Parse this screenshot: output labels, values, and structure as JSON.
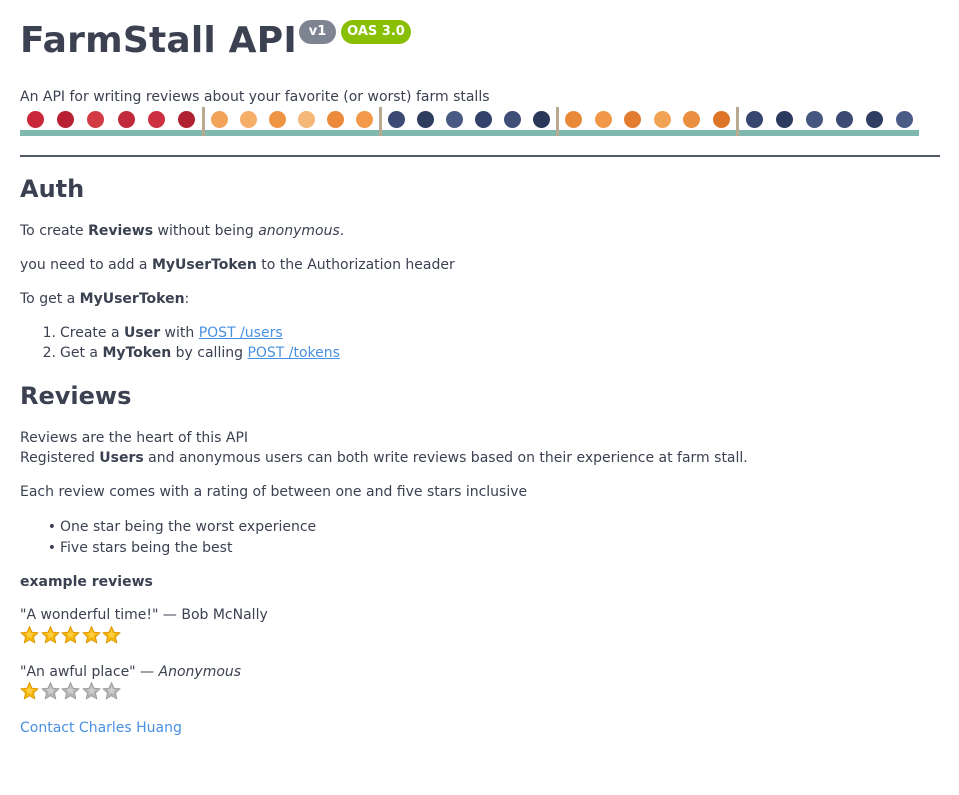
{
  "header": {
    "title": "FarmStall API",
    "version_badge": "v1",
    "oas_badge": "OAS 3.0",
    "description": "An API for writing reviews about your favorite (or worst) farm stalls"
  },
  "banner": {
    "colors": {
      "raspberry": "#c8283a",
      "orange_tomato": "#f29a4a",
      "blueberry": "#3a4a72",
      "basket_rim": "#7fb9ad"
    }
  },
  "auth": {
    "heading": "Auth",
    "line1_prefix": "To create ",
    "line1_bold": "Reviews",
    "line1_mid": " without being ",
    "line1_italic": "anonymous",
    "line1_suffix": ".",
    "line2_prefix": "you need to add a ",
    "line2_bold": "MyUserToken",
    "line2_suffix": " to the Authorization header",
    "line3_prefix": "To get a ",
    "line3_bold": "MyUserToken",
    "line3_suffix": ":",
    "steps": [
      {
        "marker": "1.",
        "prefix": "Create a ",
        "bold": "User",
        "mid": " with ",
        "link": "POST /users"
      },
      {
        "marker": "2.",
        "prefix": "Get a ",
        "bold": "MyToken",
        "mid": " by calling ",
        "link": "POST /tokens"
      }
    ]
  },
  "reviews": {
    "heading": "Reviews",
    "line1": "Reviews are the heart of this API",
    "line2_prefix": "Registered ",
    "line2_bold": "Users",
    "line2_suffix": " and anonymous users can both write reviews based on their experience at farm stall.",
    "line3": "Each review comes with a rating of between one and five stars inclusive",
    "bullets": [
      {
        "marker": "•",
        "text": "One star being the worst experience"
      },
      {
        "marker": "•",
        "text": "Five stars being the best"
      }
    ],
    "examples_heading": "example reviews",
    "examples": [
      {
        "quote": "\"A wonderful time!\"",
        "dash": " — ",
        "author": "Bob McNally",
        "rating": 5
      },
      {
        "quote": "\"An awful place\"",
        "dash": " — ",
        "author": "Anonymous",
        "rating": 1
      }
    ],
    "star_colors": {
      "filled": "#f5b50c",
      "empty": "#b5b5b5"
    }
  },
  "contact": {
    "label": "Contact Charles Huang"
  }
}
